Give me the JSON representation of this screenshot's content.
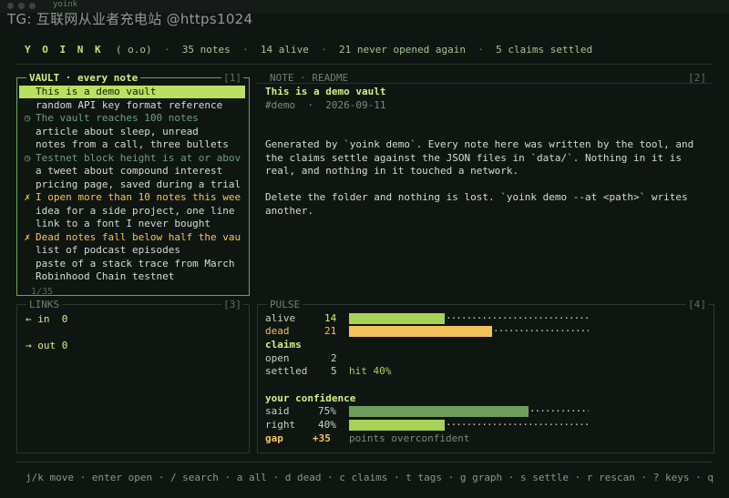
{
  "window": {
    "title": "yoink"
  },
  "watermark": "TG: 互联网从业者充电站 @https1024",
  "topbar": {
    "logo": "Y O I N K",
    "version": "( o.o)",
    "notes": "35 notes",
    "alive": "14 alive",
    "never_opened": "21 never opened again",
    "settled": "5 claims settled"
  },
  "vault": {
    "title": "VAULT · every note",
    "num": "[1]",
    "counter": "1/35",
    "items": [
      {
        "mark": "",
        "text": "This is a demo vault",
        "state": "selected"
      },
      {
        "mark": "",
        "text": "random API key format reference",
        "state": "normal"
      },
      {
        "mark": "◷",
        "text": "The vault reaches 100 notes",
        "state": "pending"
      },
      {
        "mark": "",
        "text": "article about sleep, unread",
        "state": "normal"
      },
      {
        "mark": "",
        "text": "notes from a call, three bullets",
        "state": "normal"
      },
      {
        "mark": "◷",
        "text": "Testnet block height is at or abov",
        "state": "pending"
      },
      {
        "mark": "",
        "text": "a tweet about compound interest",
        "state": "normal"
      },
      {
        "mark": "",
        "text": "pricing page, saved during a trial",
        "state": "normal"
      },
      {
        "mark": "✗",
        "text": "I open more than 10 notes this wee",
        "state": "failed"
      },
      {
        "mark": "",
        "text": "idea for a side project, one line",
        "state": "normal"
      },
      {
        "mark": "",
        "text": "link to a font I never bought",
        "state": "normal"
      },
      {
        "mark": "✗",
        "text": "Dead notes fall below half the vau",
        "state": "failed"
      },
      {
        "mark": "",
        "text": "list of podcast episodes",
        "state": "normal"
      },
      {
        "mark": "",
        "text": "paste of a stack trace from March",
        "state": "normal"
      },
      {
        "mark": "",
        "text": "Robinhood Chain testnet",
        "state": "normal"
      }
    ]
  },
  "note": {
    "panel_title": "NOTE · README",
    "num": "[2]",
    "title": "This is a demo vault",
    "tag": "#demo",
    "date": "2026-09-11",
    "body": [
      "Generated by `yoink demo`. Every note here was written by the tool, and the claims settle against the JSON files in `data/`. Nothing in it is real, and nothing in it touched a network.",
      "Delete the folder and nothing is lost. `yoink demo --at <path>` writes another."
    ]
  },
  "links": {
    "title": "LINKS",
    "num": "[3]",
    "in": "← in  0",
    "out": "→ out 0"
  },
  "pulse": {
    "title": "PULSE",
    "num": "[4]",
    "alive_label": "alive",
    "alive_value": "14",
    "alive_fraction": 0.4,
    "dead_label": "dead",
    "dead_value": "21",
    "dead_fraction": 0.6,
    "claims_heading": "claims",
    "open_label": "open",
    "open_value": "2",
    "settled_label": "settled",
    "settled_value": "5",
    "hit_text": "hit 40%",
    "confidence_heading": "your confidence",
    "said_label": "said",
    "said_value": "75%",
    "said_fraction": 0.75,
    "right_label": "right",
    "right_value": "40%",
    "right_fraction": 0.4,
    "gap_label": "gap",
    "gap_value": "+35",
    "gap_text": "points overconfident"
  },
  "colors": {
    "alive_bar": "#a9d157",
    "dead_bar": "#f3c25a",
    "said_bar": "#6e9d5e",
    "right_bar": "#a9d157",
    "accent": "#d5ef7e"
  },
  "help": "j/k move · enter open · / search · a all · d dead · c claims · t tags · g graph · s settle · r rescan · ? keys · q"
}
